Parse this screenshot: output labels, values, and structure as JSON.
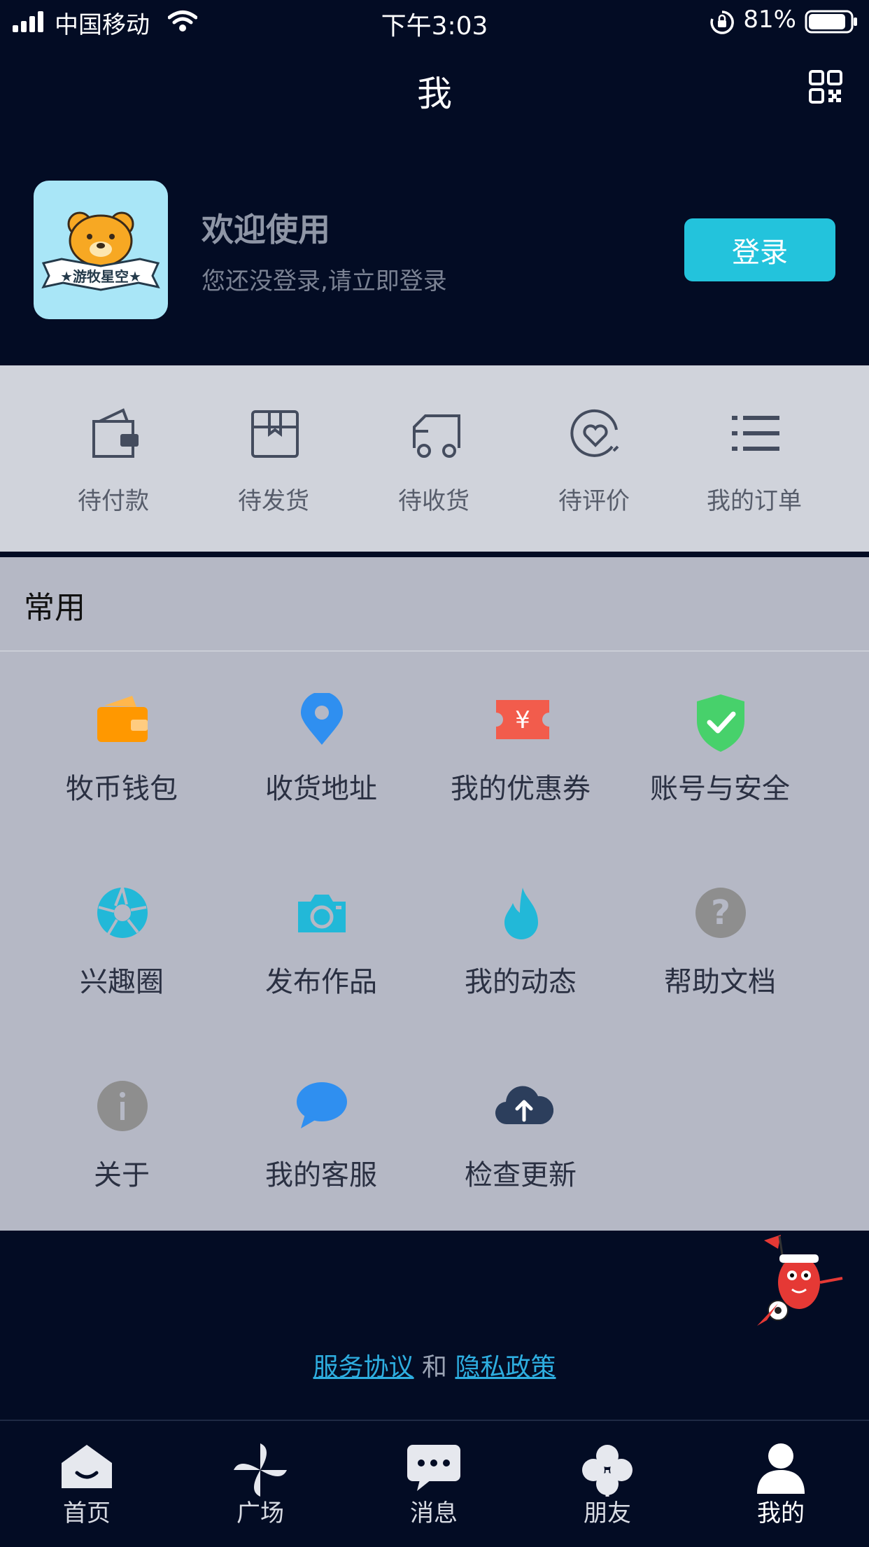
{
  "status_bar": {
    "carrier": "中国移动",
    "time": "下午3:03",
    "battery": "81%"
  },
  "navbar": {
    "title": "我"
  },
  "profile": {
    "logo_text": "游牧星空",
    "welcome": "欢迎使用",
    "subtitle": "您还没登录,请立即登录",
    "login_button": "登录"
  },
  "orders": [
    {
      "label": "待付款",
      "icon": "wallet-icon"
    },
    {
      "label": "待发货",
      "icon": "box-icon"
    },
    {
      "label": "待收货",
      "icon": "truck-icon"
    },
    {
      "label": "待评价",
      "icon": "review-heart-icon"
    },
    {
      "label": "我的订单",
      "icon": "list-icon"
    }
  ],
  "common": {
    "title": "常用",
    "items": [
      {
        "label": "牧币钱包",
        "icon": "wallet-icon",
        "color": "#ff9800"
      },
      {
        "label": "收货地址",
        "icon": "location-pin-icon",
        "color": "#2f8ff0"
      },
      {
        "label": "我的优惠券",
        "icon": "coupon-icon",
        "color": "#f25c4c"
      },
      {
        "label": "账号与安全",
        "icon": "shield-check-icon",
        "color": "#47d16b"
      },
      {
        "label": "兴趣圈",
        "icon": "aperture-icon",
        "color": "#22b8d8"
      },
      {
        "label": "发布作品",
        "icon": "camera-icon",
        "color": "#22b8d8"
      },
      {
        "label": "我的动态",
        "icon": "flame-icon",
        "color": "#22b8d8"
      },
      {
        "label": "帮助文档",
        "icon": "question-icon",
        "color": "#8e8e8e"
      },
      {
        "label": "关于",
        "icon": "info-icon",
        "color": "#8e8e8e"
      },
      {
        "label": "我的客服",
        "icon": "chat-bubble-icon",
        "color": "#2f8ff0"
      },
      {
        "label": "检查更新",
        "icon": "cloud-upload-icon",
        "color": "#2c3e5c"
      }
    ]
  },
  "agreement": {
    "service": "服务协议",
    "and": "和",
    "privacy": "隐私政策"
  },
  "tabs": [
    {
      "label": "首页",
      "icon": "home-icon"
    },
    {
      "label": "广场",
      "icon": "pinwheel-icon"
    },
    {
      "label": "消息",
      "icon": "message-icon"
    },
    {
      "label": "朋友",
      "icon": "clover-icon"
    },
    {
      "label": "我的",
      "icon": "person-icon",
      "active": true
    }
  ]
}
